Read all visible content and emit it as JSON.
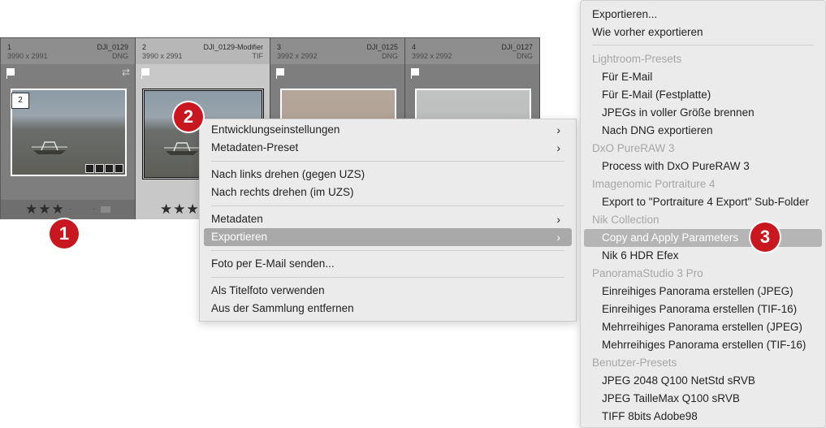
{
  "filmstrip": {
    "cells": [
      {
        "index": "1",
        "filename": "DJI_0129",
        "dims": "3990 x 2991",
        "type": "DNG",
        "stars": "★★★",
        "dots": "· ·",
        "badge": "2"
      },
      {
        "index": "2",
        "filename": "DJI_0129-Modifier",
        "dims": "3990 x 2991",
        "type": "TIF",
        "stars": "★★★"
      },
      {
        "index": "3",
        "filename": "DJI_0125",
        "dims": "3992 x 2992",
        "type": "DNG"
      },
      {
        "index": "4",
        "filename": "DJI_0127",
        "dims": "3992 x 2992",
        "type": "DNG"
      }
    ]
  },
  "callouts": {
    "one": "1",
    "two": "2",
    "three": "3"
  },
  "context_menu": {
    "items": [
      "Entwicklungseinstellungen",
      "Metadaten-Preset",
      "Nach links drehen (gegen UZS)",
      "Nach rechts drehen (im UZS)",
      "Metadaten",
      "Exportieren",
      "Foto per E-Mail senden...",
      "Als Titelfoto verwenden",
      "Aus der Sammlung entfernen"
    ],
    "arrow": "›"
  },
  "export_menu": {
    "items": [
      "Exportieren...",
      "Wie vorher exportieren",
      "Lightroom-Presets",
      "Für E-Mail",
      "Für E-Mail (Festplatte)",
      "JPEGs in voller Größe brennen",
      "Nach DNG exportieren",
      "DxO PureRAW 3",
      "Process with DxO PureRAW 3",
      "Imagenomic Portraiture 4",
      "Export to \"Portraiture 4 Export\" Sub-Folder",
      "Nik Collection",
      "Copy and Apply Parameters",
      "Nik 6 HDR Efex",
      "PanoramaStudio 3 Pro",
      "Einreihiges Panorama erstellen (JPEG)",
      "Einreihiges Panorama erstellen (TIF-16)",
      "Mehrreihiges Panorama erstellen (JPEG)",
      "Mehrreihiges Panorama erstellen (TIF-16)",
      "Benutzer-Presets",
      "JPEG 2048 Q100 NetStd sRVB",
      "JPEG TailleMax Q100 sRVB",
      "TIFF 8bits Adobe98"
    ]
  },
  "colors": {
    "accent_red": "#c8171e",
    "highlight": "#a9a9a9",
    "menu_bg": "#ebebeb"
  }
}
